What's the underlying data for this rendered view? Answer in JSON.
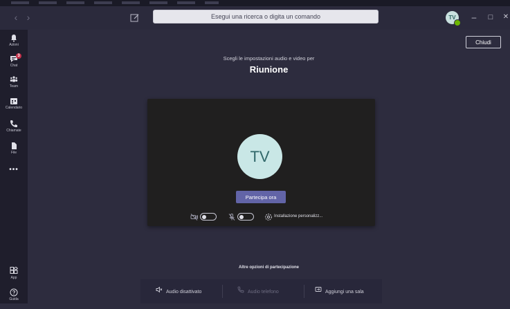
{
  "titlebar": {
    "search_placeholder": "Esegui una ricerca o digita un comando",
    "user_initials": "TV",
    "minimize_glyph": "–",
    "maximize_glyph": "□",
    "close_glyph": "✕",
    "back_glyph": "‹",
    "forward_glyph": "›"
  },
  "rail": {
    "items": [
      {
        "label": "Azioni",
        "icon": "bell-icon"
      },
      {
        "label": "Chat",
        "icon": "chat-icon",
        "badge": "3"
      },
      {
        "label": "Team",
        "icon": "teams-icon"
      },
      {
        "label": "Calendario",
        "icon": "calendar-icon"
      },
      {
        "label": "Chiamate",
        "icon": "phone-icon"
      },
      {
        "label": "File",
        "icon": "file-icon"
      }
    ],
    "more": "•••",
    "bottom": [
      {
        "label": "App",
        "icon": "apps-icon"
      },
      {
        "label": "Guida",
        "icon": "help-icon"
      }
    ]
  },
  "meeting": {
    "close_button": "Chiudi",
    "subtitle": "Scegli le impostazioni audio e video per",
    "title": "Riunione",
    "avatar_initials": "TV",
    "join_button": "Partecipa ora",
    "custom_setup": "Installazione personalizz...",
    "other_options_title": "Altre opzioni di partecipazione",
    "options": [
      {
        "label": "Audio disattivato",
        "icon": "speaker-off-icon",
        "enabled": true
      },
      {
        "label": "Audio telefono",
        "icon": "phone-icon",
        "enabled": false
      },
      {
        "label": "Aggiungi una sala",
        "icon": "cast-icon",
        "enabled": true
      }
    ]
  },
  "colors": {
    "accent": "#6264a7",
    "background": "#2d2c3e",
    "rail": "#1f1e2c",
    "badge": "#c4314b",
    "presence": "#6bb700"
  }
}
